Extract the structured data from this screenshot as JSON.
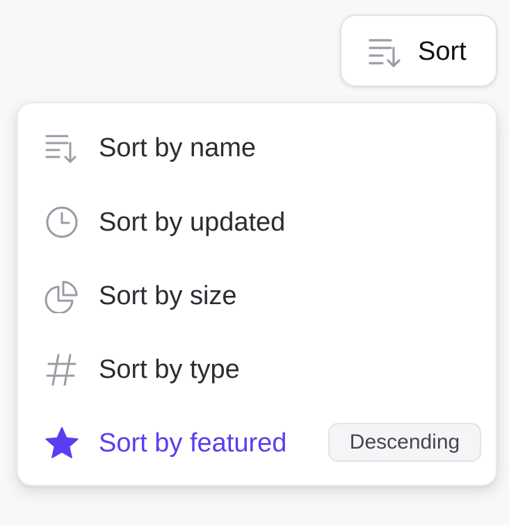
{
  "sort_button": {
    "label": "Sort",
    "icon": "sort-lines-arrow-down-icon"
  },
  "menu": {
    "items": [
      {
        "label": "Sort by name",
        "icon": "sort-lines-arrow-down-icon",
        "active": false
      },
      {
        "label": "Sort by updated",
        "icon": "clock-icon",
        "active": false
      },
      {
        "label": "Sort by size",
        "icon": "pie-chart-icon",
        "active": false
      },
      {
        "label": "Sort by type",
        "icon": "hash-icon",
        "active": false
      },
      {
        "label": "Sort by featured",
        "icon": "star-icon",
        "active": true,
        "badge": "Descending"
      }
    ]
  },
  "colors": {
    "accent": "#5b3df0",
    "text": "#2c2c33",
    "icon": "#9b9ba5"
  }
}
